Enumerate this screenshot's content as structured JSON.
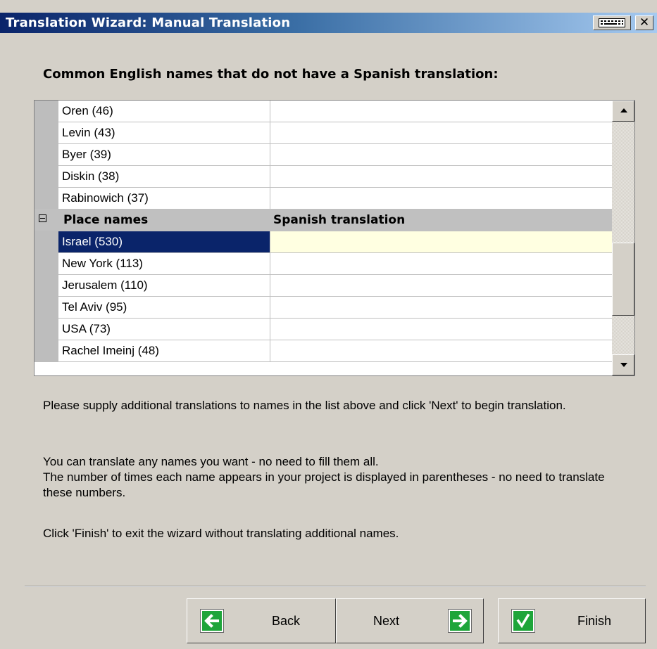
{
  "window": {
    "title": "Translation Wizard: Manual Translation",
    "close_glyph": "✕",
    "keyboard_icon": "keyboard-icon"
  },
  "heading": "Common English names that do not have a Spanish translation:",
  "grid": {
    "rows": [
      {
        "type": "item",
        "name": "Oren (46)",
        "translation": ""
      },
      {
        "type": "item",
        "name": "Levin (43)",
        "translation": ""
      },
      {
        "type": "item",
        "name": "Byer (39)",
        "translation": ""
      },
      {
        "type": "item",
        "name": "Diskin (38)",
        "translation": ""
      },
      {
        "type": "item",
        "name": "Rabinowich (37)",
        "translation": ""
      },
      {
        "type": "group",
        "name": "Place names",
        "translation": "Spanish translation"
      },
      {
        "type": "item",
        "name": "Israel (530)",
        "translation": "",
        "selected": true
      },
      {
        "type": "item",
        "name": "New York (113)",
        "translation": ""
      },
      {
        "type": "item",
        "name": "Jerusalem (110)",
        "translation": ""
      },
      {
        "type": "item",
        "name": "Tel Aviv (95)",
        "translation": ""
      },
      {
        "type": "item",
        "name": "USA (73)",
        "translation": ""
      },
      {
        "type": "item",
        "name": "Rachel Imeinj (48)",
        "translation": ""
      }
    ],
    "selection_color": "#0a246a",
    "edit_cell_color": "#ffffe1"
  },
  "instructions": {
    "p1": "Please supply additional translations to names in the list above and click 'Next' to begin translation.",
    "p2_line1": "You can translate any names you want - no need to fill them all.",
    "p2_line2": "The number of times each name appears in your project is displayed in parentheses - no need to translate these numbers.",
    "p3": "Click 'Finish' to exit the wizard without translating additional names."
  },
  "buttons": {
    "back": "Back",
    "next": "Next",
    "finish": "Finish",
    "back_icon": "arrow-left-icon",
    "next_icon": "arrow-right-icon",
    "finish_icon": "checkmark-icon",
    "icon_color": "#1ea53a"
  }
}
